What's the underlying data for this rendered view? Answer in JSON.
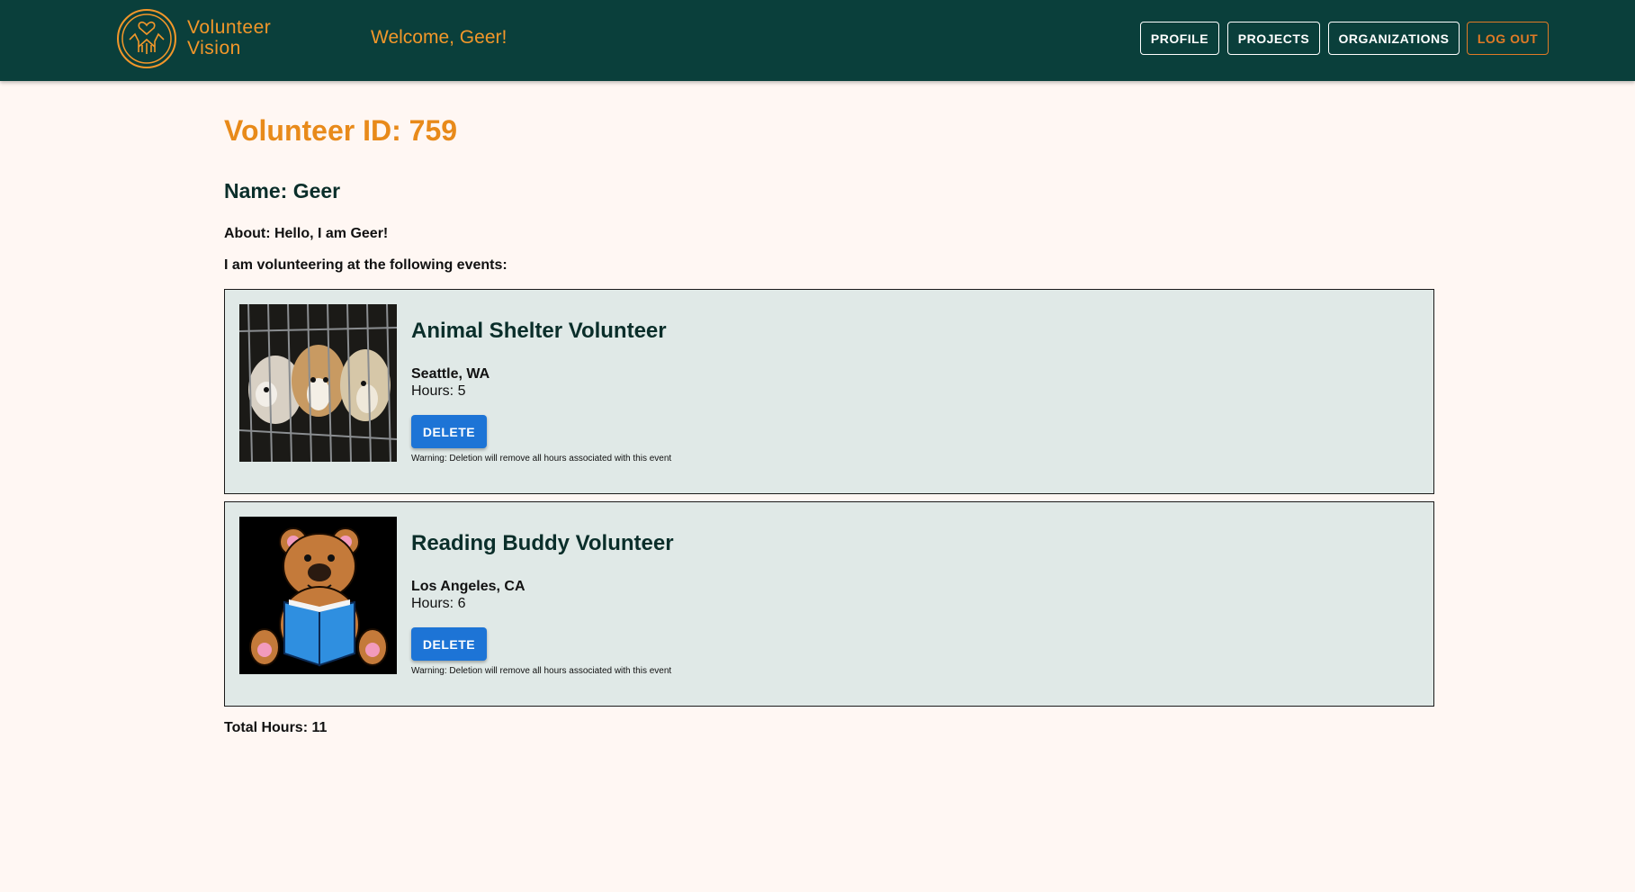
{
  "header": {
    "brand_line1": "Volunteer",
    "brand_line2": "Vision",
    "welcome": "Welcome, Geer!",
    "nav": {
      "profile": "PROFILE",
      "projects": "PROJECTS",
      "organizations": "ORGANIZATIONS",
      "logout": "LOG OUT"
    }
  },
  "volunteer": {
    "id_heading": "Volunteer ID: 759",
    "name": "Name: Geer",
    "about": "About: Hello, I am Geer!",
    "events_intro": "I am volunteering at the following events:"
  },
  "events": [
    {
      "title": "Animal Shelter Volunteer",
      "location": "Seattle, WA",
      "hours": "Hours: 5",
      "delete_label": "DELETE",
      "warning": "Warning: Deletion will remove all hours associated with this event"
    },
    {
      "title": "Reading Buddy Volunteer",
      "location": "Los Angeles, CA",
      "hours": "Hours: 6",
      "delete_label": "DELETE",
      "warning": "Warning: Deletion will remove all hours associated with this event"
    }
  ],
  "total_hours": "Total Hours: 11",
  "colors": {
    "navbar": "#0a3f3b",
    "accent": "#f2972a",
    "background": "#fff7f3",
    "card": "#e0e9e7",
    "button": "#1d74d6"
  }
}
